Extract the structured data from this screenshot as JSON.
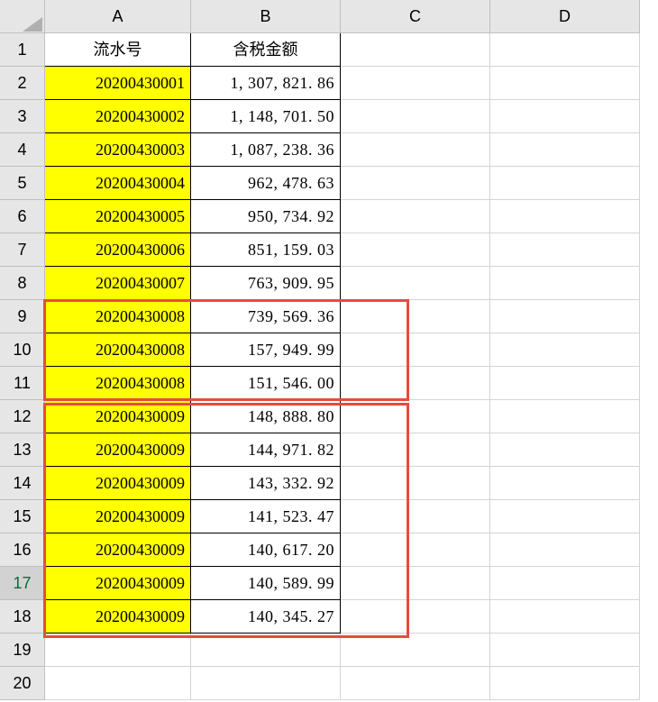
{
  "columns": {
    "A": "A",
    "B": "B",
    "C": "C",
    "D": "D"
  },
  "headers": {
    "colA": "流水号",
    "colB": "含税金额"
  },
  "rowLabels": {
    "r1": "1",
    "r2": "2",
    "r3": "3",
    "r4": "4",
    "r5": "5",
    "r6": "6",
    "r7": "7",
    "r8": "8",
    "r9": "9",
    "r10": "10",
    "r11": "11",
    "r12": "12",
    "r13": "13",
    "r14": "14",
    "r15": "15",
    "r16": "16",
    "r17": "17",
    "r18": "18",
    "r19": "19",
    "r20": "20"
  },
  "data": {
    "r2": {
      "a": "20200430001",
      "b": "1, 307, 821. 86"
    },
    "r3": {
      "a": "20200430002",
      "b": "1, 148, 701. 50"
    },
    "r4": {
      "a": "20200430003",
      "b": "1, 087, 238. 36"
    },
    "r5": {
      "a": "20200430004",
      "b": "962, 478. 63"
    },
    "r6": {
      "a": "20200430005",
      "b": "950, 734. 92"
    },
    "r7": {
      "a": "20200430006",
      "b": "851, 159. 03"
    },
    "r8": {
      "a": "20200430007",
      "b": "763, 909. 95"
    },
    "r9": {
      "a": "20200430008",
      "b": "739, 569. 36"
    },
    "r10": {
      "a": "20200430008",
      "b": "157, 949. 99"
    },
    "r11": {
      "a": "20200430008",
      "b": "151, 546. 00"
    },
    "r12": {
      "a": "20200430009",
      "b": "148, 888. 80"
    },
    "r13": {
      "a": "20200430009",
      "b": "144, 971. 82"
    },
    "r14": {
      "a": "20200430009",
      "b": "143, 332. 92"
    },
    "r15": {
      "a": "20200430009",
      "b": "141, 523. 47"
    },
    "r16": {
      "a": "20200430009",
      "b": "140, 617. 20"
    },
    "r17": {
      "a": "20200430009",
      "b": "140, 589. 99"
    },
    "r18": {
      "a": "20200430009",
      "b": "140, 345. 27"
    }
  }
}
